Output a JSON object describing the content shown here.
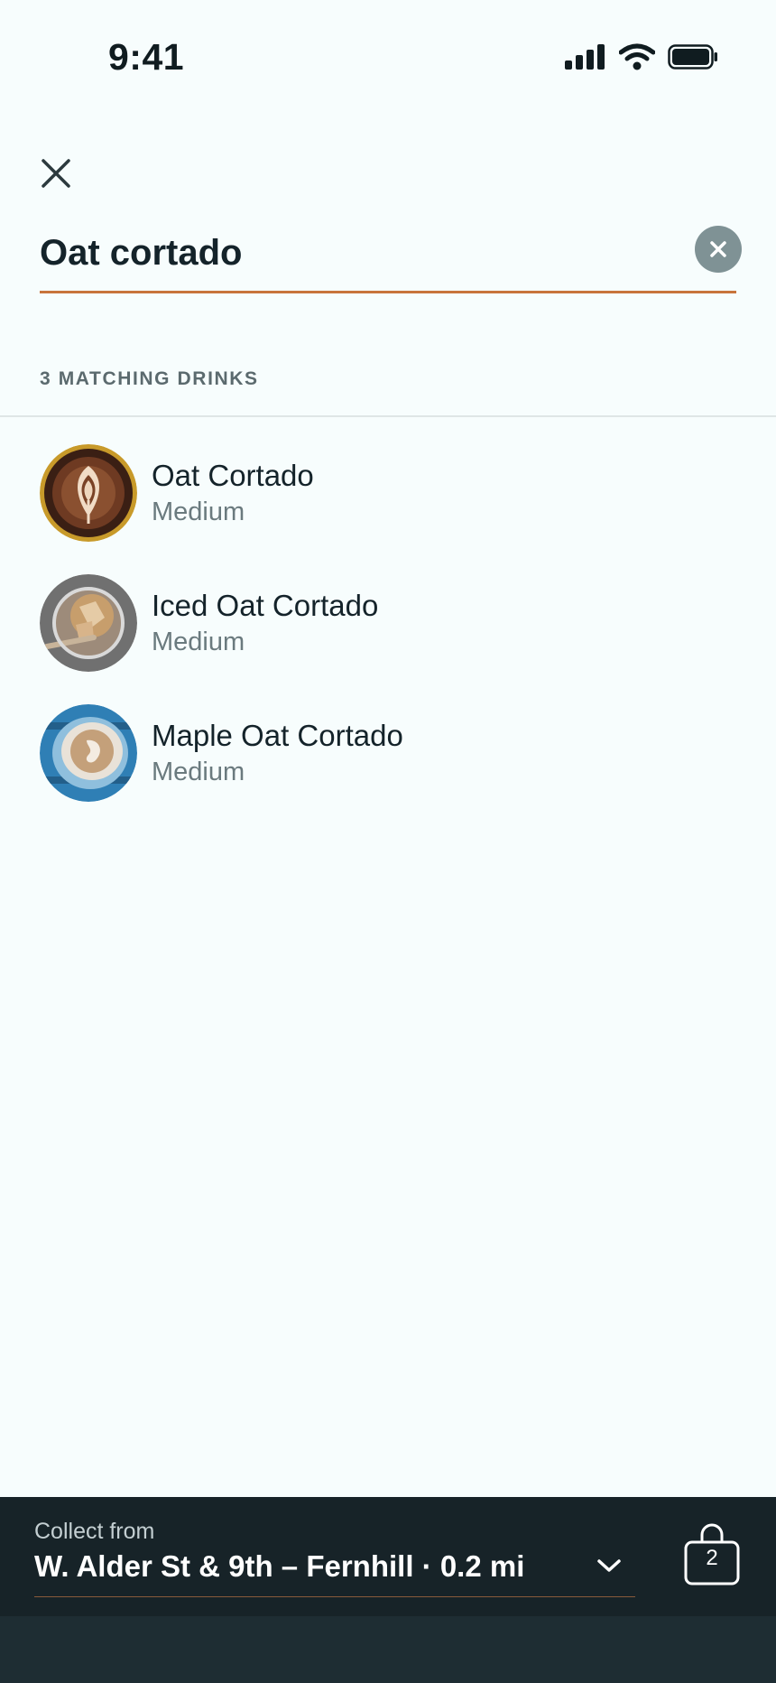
{
  "status_bar": {
    "time": "9:41"
  },
  "search": {
    "value": "Oat cortado",
    "clear_icon": "clear-circle-x-icon"
  },
  "results": {
    "header": "3 MATCHING DRINKS",
    "items": [
      {
        "name": "Oat Cortado",
        "size": "Medium"
      },
      {
        "name": "Iced Oat Cortado",
        "size": "Medium"
      },
      {
        "name": "Maple Oat Cortado",
        "size": "Medium"
      }
    ]
  },
  "pickup": {
    "label": "Collect from",
    "store": "W. Alder St & 9th – Fernhill · 0.2 mi"
  },
  "bag": {
    "count": "2"
  },
  "colors": {
    "background": "#f7fdfd",
    "accent_underline": "#c8743c",
    "bottom_bar": "#172328",
    "clear_button": "#7f9295"
  }
}
